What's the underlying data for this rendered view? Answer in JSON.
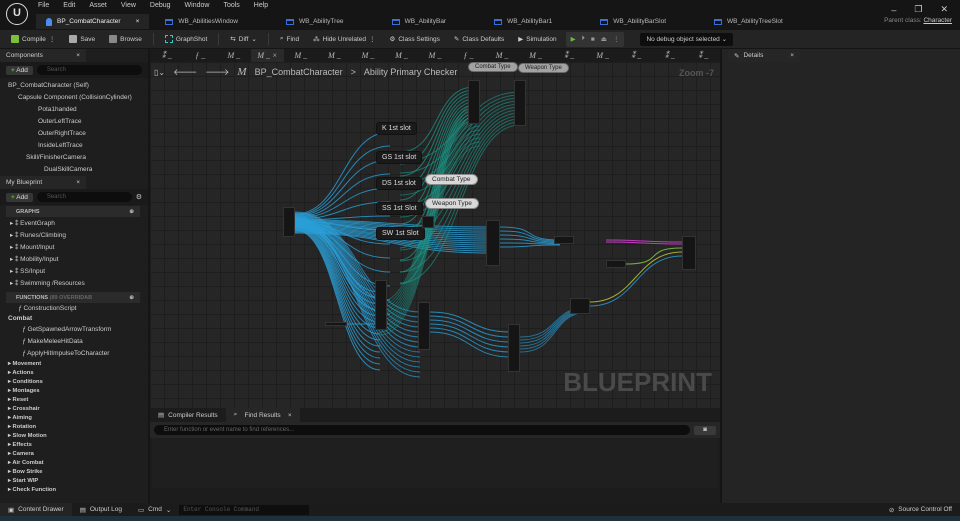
{
  "menu": [
    "File",
    "Edit",
    "Asset",
    "View",
    "Debug",
    "Window",
    "Tools",
    "Help"
  ],
  "tabs": [
    {
      "label": "BP_CombatCharacter",
      "active": true
    },
    {
      "label": "WB_AbilitiesWindow"
    },
    {
      "label": "WB_AbilityTree"
    },
    {
      "label": "WB_AbilityBar"
    },
    {
      "label": "WB_AbilityBar1"
    },
    {
      "label": "WB_AbilityBarSlot"
    },
    {
      "label": "WB_AbilityTreeSlot"
    }
  ],
  "parent_class": {
    "label": "Parent class:",
    "value": "Character"
  },
  "toolbar": {
    "compile": "Compile",
    "save": "Save",
    "browse": "Browse",
    "graphshot": "GraphShot",
    "diff": "Diff",
    "find": "Find",
    "hide_unrelated": "Hide Unrelated",
    "class_settings": "Class Settings",
    "class_defaults": "Class Defaults",
    "simulation": "Simulation",
    "debug_object": "No debug object selected"
  },
  "components": {
    "title": "Components",
    "add": "Add",
    "search_placeholder": "Search",
    "items": [
      "BP_CombatCharacter (Self)",
      "Capsule Component (CollisionCylinder)",
      "Pota1handed",
      "OuterLeftTrace",
      "OuterRightTrace",
      "InsideLeftTrace",
      "Skill/FinisherCamera",
      "DualSkillCamera"
    ]
  },
  "my_blueprint": {
    "title": "My Blueprint",
    "add": "Add",
    "search_placeholder": "Search",
    "graphs_label": "GRAPHS",
    "graphs": [
      "EventGraph",
      "Runes/Climbing",
      "Mount/Input",
      "Mobility/Input",
      "SS/Input",
      "Swimming /Resources"
    ],
    "functions_label": "FUNCTIONS",
    "functions_count": "(89 OVERRIDAB",
    "construction": "ConstructionScript",
    "combat_label": "Combat",
    "combat_funcs": [
      "GetSpawnedArrowTransform",
      "MakeMeleeHitData",
      "ApplyHitImpulseToCharacter"
    ],
    "categories": [
      "Movement",
      "Actions",
      "Conditions",
      "Montages",
      "Reset",
      "Crosshair",
      "Aiming",
      "Rotation",
      "Slow Motion",
      "Effects",
      "Camera",
      "Air Combat",
      "Bow Strike",
      "Start WIP",
      "Check Function"
    ]
  },
  "graph": {
    "breadcrumb_root": "BP_CombatCharacter",
    "breadcrumb_current": "Ability Primary Checker",
    "zoom": "Zoom -7",
    "watermark": "BLUEPRINT",
    "comments": [
      "K 1st slot",
      "GS 1st slot",
      "DS 1st slot",
      "SS 1st Slot",
      "SW 1st Slot"
    ],
    "pills": [
      "Combat Type",
      "Weapon Type"
    ]
  },
  "details": {
    "title": "Details"
  },
  "bottom": {
    "tab1": "Compiler Results",
    "tab2": "Find Results",
    "search_placeholder": "Enter function or event name to find references..."
  },
  "status": {
    "content_drawer": "Content Drawer",
    "output_log": "Output Log",
    "cmd": "Cmd",
    "console_placeholder": "Enter Console Command",
    "source_control": "Source Control Off"
  }
}
